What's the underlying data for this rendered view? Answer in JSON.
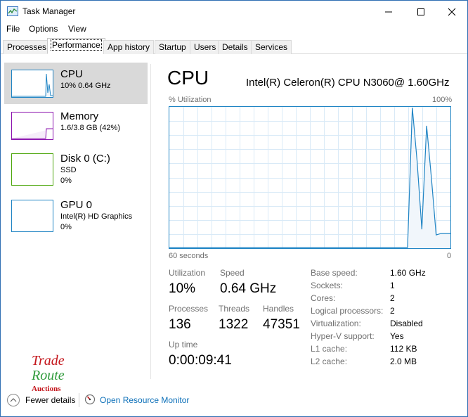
{
  "window": {
    "title": "Task Manager"
  },
  "menu": {
    "file": "File",
    "options": "Options",
    "view": "View"
  },
  "tabs": [
    {
      "label": "Processes"
    },
    {
      "label": "Performance"
    },
    {
      "label": "App history"
    },
    {
      "label": "Startup"
    },
    {
      "label": "Users"
    },
    {
      "label": "Details"
    },
    {
      "label": "Services"
    }
  ],
  "active_tab": "Performance",
  "sidebar": {
    "items": [
      {
        "title": "CPU",
        "line1": "10% 0.64 GHz",
        "line2": "",
        "color": "#1f84c4",
        "selected": true
      },
      {
        "title": "Memory",
        "line1": "1.6/3.8 GB (42%)",
        "line2": "",
        "color": "#8b12ae",
        "selected": false
      },
      {
        "title": "Disk 0 (C:)",
        "line1": "SSD",
        "line2": "0%",
        "color": "#4da60c",
        "selected": false
      },
      {
        "title": "GPU 0",
        "line1": "Intel(R) HD Graphics",
        "line2": "0%",
        "color": "#1f84c4",
        "selected": false
      }
    ]
  },
  "main": {
    "title": "CPU",
    "model": "Intel(R) Celeron(R) CPU N3060@ 1.60GHz",
    "graph": {
      "ylabel": "% Utilization",
      "ymax_label": "100%",
      "xlabel_left": "60 seconds",
      "xlabel_right": "0",
      "line_color": "#1f84c4",
      "fill_color": "#f1f6fb",
      "grid_color": "#d9eaf7",
      "utilization_samples": [
        0,
        0,
        0,
        0,
        0,
        0,
        0,
        0,
        0,
        0,
        0,
        0,
        0,
        0,
        0,
        0,
        0,
        0,
        0,
        0,
        0,
        0,
        0,
        0,
        0,
        0,
        0,
        0,
        0,
        0,
        0,
        0,
        0,
        0,
        0,
        0,
        0,
        0,
        0,
        0,
        0,
        0,
        0,
        0,
        0,
        0,
        0,
        0,
        0,
        0,
        0,
        100,
        62,
        13,
        87,
        50,
        9,
        10,
        10,
        10
      ]
    },
    "stats": {
      "utilization_label": "Utilization",
      "utilization_value": "10%",
      "speed_label": "Speed",
      "speed_value": "0.64 GHz",
      "processes_label": "Processes",
      "processes_value": "136",
      "threads_label": "Threads",
      "threads_value": "1322",
      "handles_label": "Handles",
      "handles_value": "47351",
      "uptime_label": "Up time",
      "uptime_value": "0:00:09:41"
    },
    "specs": [
      {
        "label": "Base speed:",
        "value": "1.60 GHz"
      },
      {
        "label": "Sockets:",
        "value": "1"
      },
      {
        "label": "Cores:",
        "value": "2"
      },
      {
        "label": "Logical processors:",
        "value": "2"
      },
      {
        "label": "Virtualization:",
        "value": "Disabled"
      },
      {
        "label": "Hyper-V support:",
        "value": "Yes"
      },
      {
        "label": "L1 cache:",
        "value": "112 KB"
      },
      {
        "label": "L2 cache:",
        "value": "2.0 MB"
      }
    ]
  },
  "watermark": {
    "line1": "Trade",
    "line2": "Route",
    "line3": "Auctions"
  },
  "footer": {
    "fewer_details": "Fewer details",
    "open_resource_monitor": "Open Resource Monitor"
  }
}
